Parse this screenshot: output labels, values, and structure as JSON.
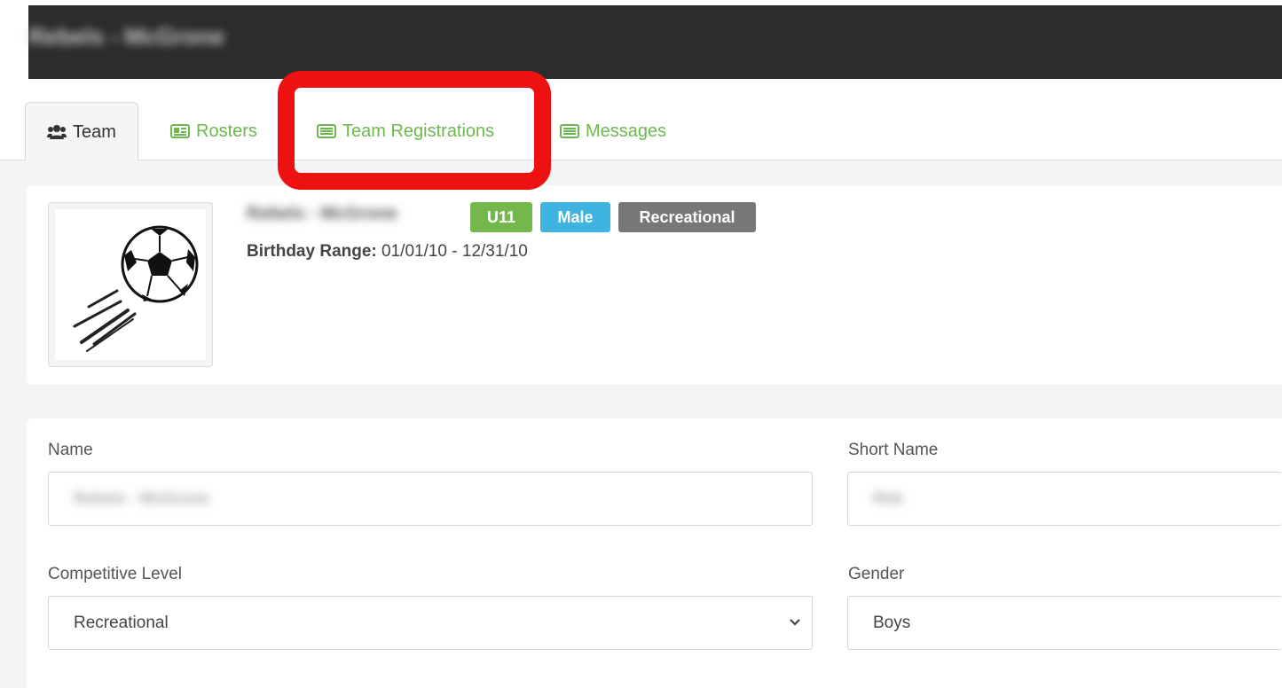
{
  "header": {
    "title": "Rebels - McGrone"
  },
  "tabs": [
    {
      "label": "Team",
      "icon": "users-icon"
    },
    {
      "label": "Rosters",
      "icon": "id-card-icon"
    },
    {
      "label": "Team Registrations",
      "icon": "list-icon"
    },
    {
      "label": "Messages",
      "icon": "list-icon"
    }
  ],
  "team": {
    "name": "Rebels - McGrone",
    "badges": [
      "U11",
      "Male",
      "Recreational"
    ],
    "birthday_label": "Birthday Range:",
    "birthday_value": "01/01/10 - 12/31/10"
  },
  "form": {
    "name_label": "Name",
    "name_value": "Rebels - McGrone",
    "short_name_label": "Short Name",
    "short_name_value": "Reb",
    "competitive_level_label": "Competitive Level",
    "competitive_level_value": "Recreational",
    "gender_label": "Gender",
    "gender_value": "Boys"
  },
  "colors": {
    "tab_link": "#6cb84f",
    "badge_green": "#74b84b",
    "badge_blue": "#40b4e0",
    "badge_gray": "#777779",
    "highlight": "#ee1111",
    "topbar": "#2b2c2e"
  }
}
